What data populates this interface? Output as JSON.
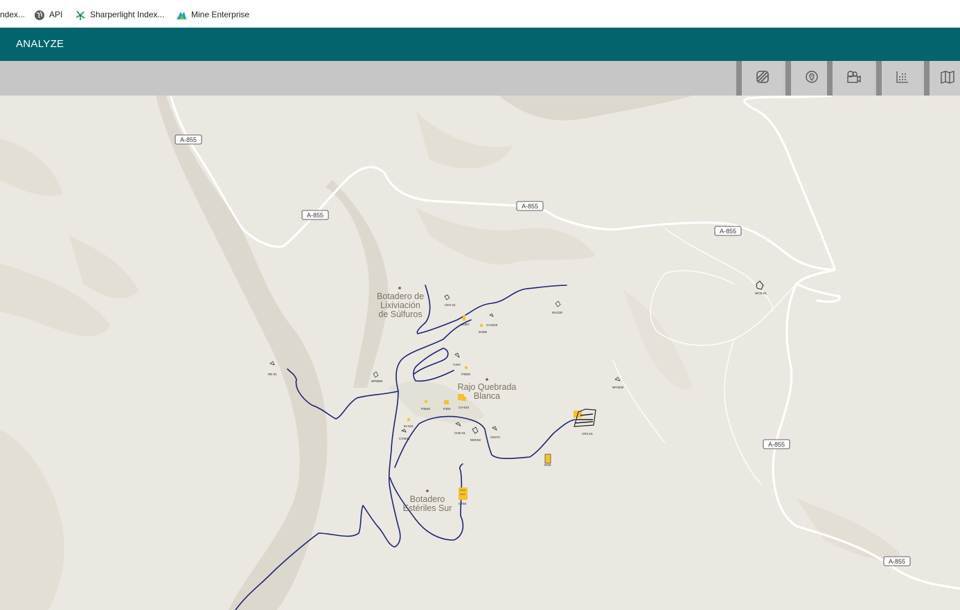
{
  "bookmarks": [
    {
      "label": "ndex...",
      "icon": "none"
    },
    {
      "label": "API",
      "icon": "globe-icon"
    },
    {
      "label": "Sharperlight Index...",
      "icon": "sharperlight-icon"
    },
    {
      "label": "Mine Enterprise",
      "icon": "mine-enterprise-icon"
    }
  ],
  "app": {
    "title": "ANALYZE"
  },
  "toolbar": {
    "buttons": [
      {
        "icon": "layers-stripe-icon"
      },
      {
        "icon": "location-pin-icon"
      },
      {
        "icon": "equipment-camera-icon"
      },
      {
        "icon": "scatter-grid-icon"
      },
      {
        "icon": "map-icon"
      }
    ]
  },
  "map": {
    "road_shields": [
      "A-855",
      "A-855",
      "A-855",
      "A-855",
      "A-855",
      "A-855"
    ],
    "places": {
      "botadero_sulfuros": [
        "Botadero de",
        "Lixiviación",
        "de Súlfuros"
      ],
      "rajo": [
        "Rajo Quebrada",
        "Blanca"
      ],
      "botadero_esteriles": [
        "Botadero",
        "Estériles Sur"
      ]
    },
    "equipment_labels": [
      "CEX-31",
      "IN307",
      "CV4040",
      "IN306",
      "INV230",
      "C4e4",
      "P3020",
      "RE-01",
      "NP8080",
      "P3040",
      "P302",
      "CV-610",
      "IN-316",
      "CVW01",
      "CHE-01",
      "DMV02",
      "CE272",
      "CR3-16",
      "IN15",
      "CT58",
      "NP3030",
      "WCE-01"
    ],
    "colors": {
      "haul_road": "#1c2372",
      "equipment": "#f2c230",
      "road": "#ffffff"
    }
  }
}
